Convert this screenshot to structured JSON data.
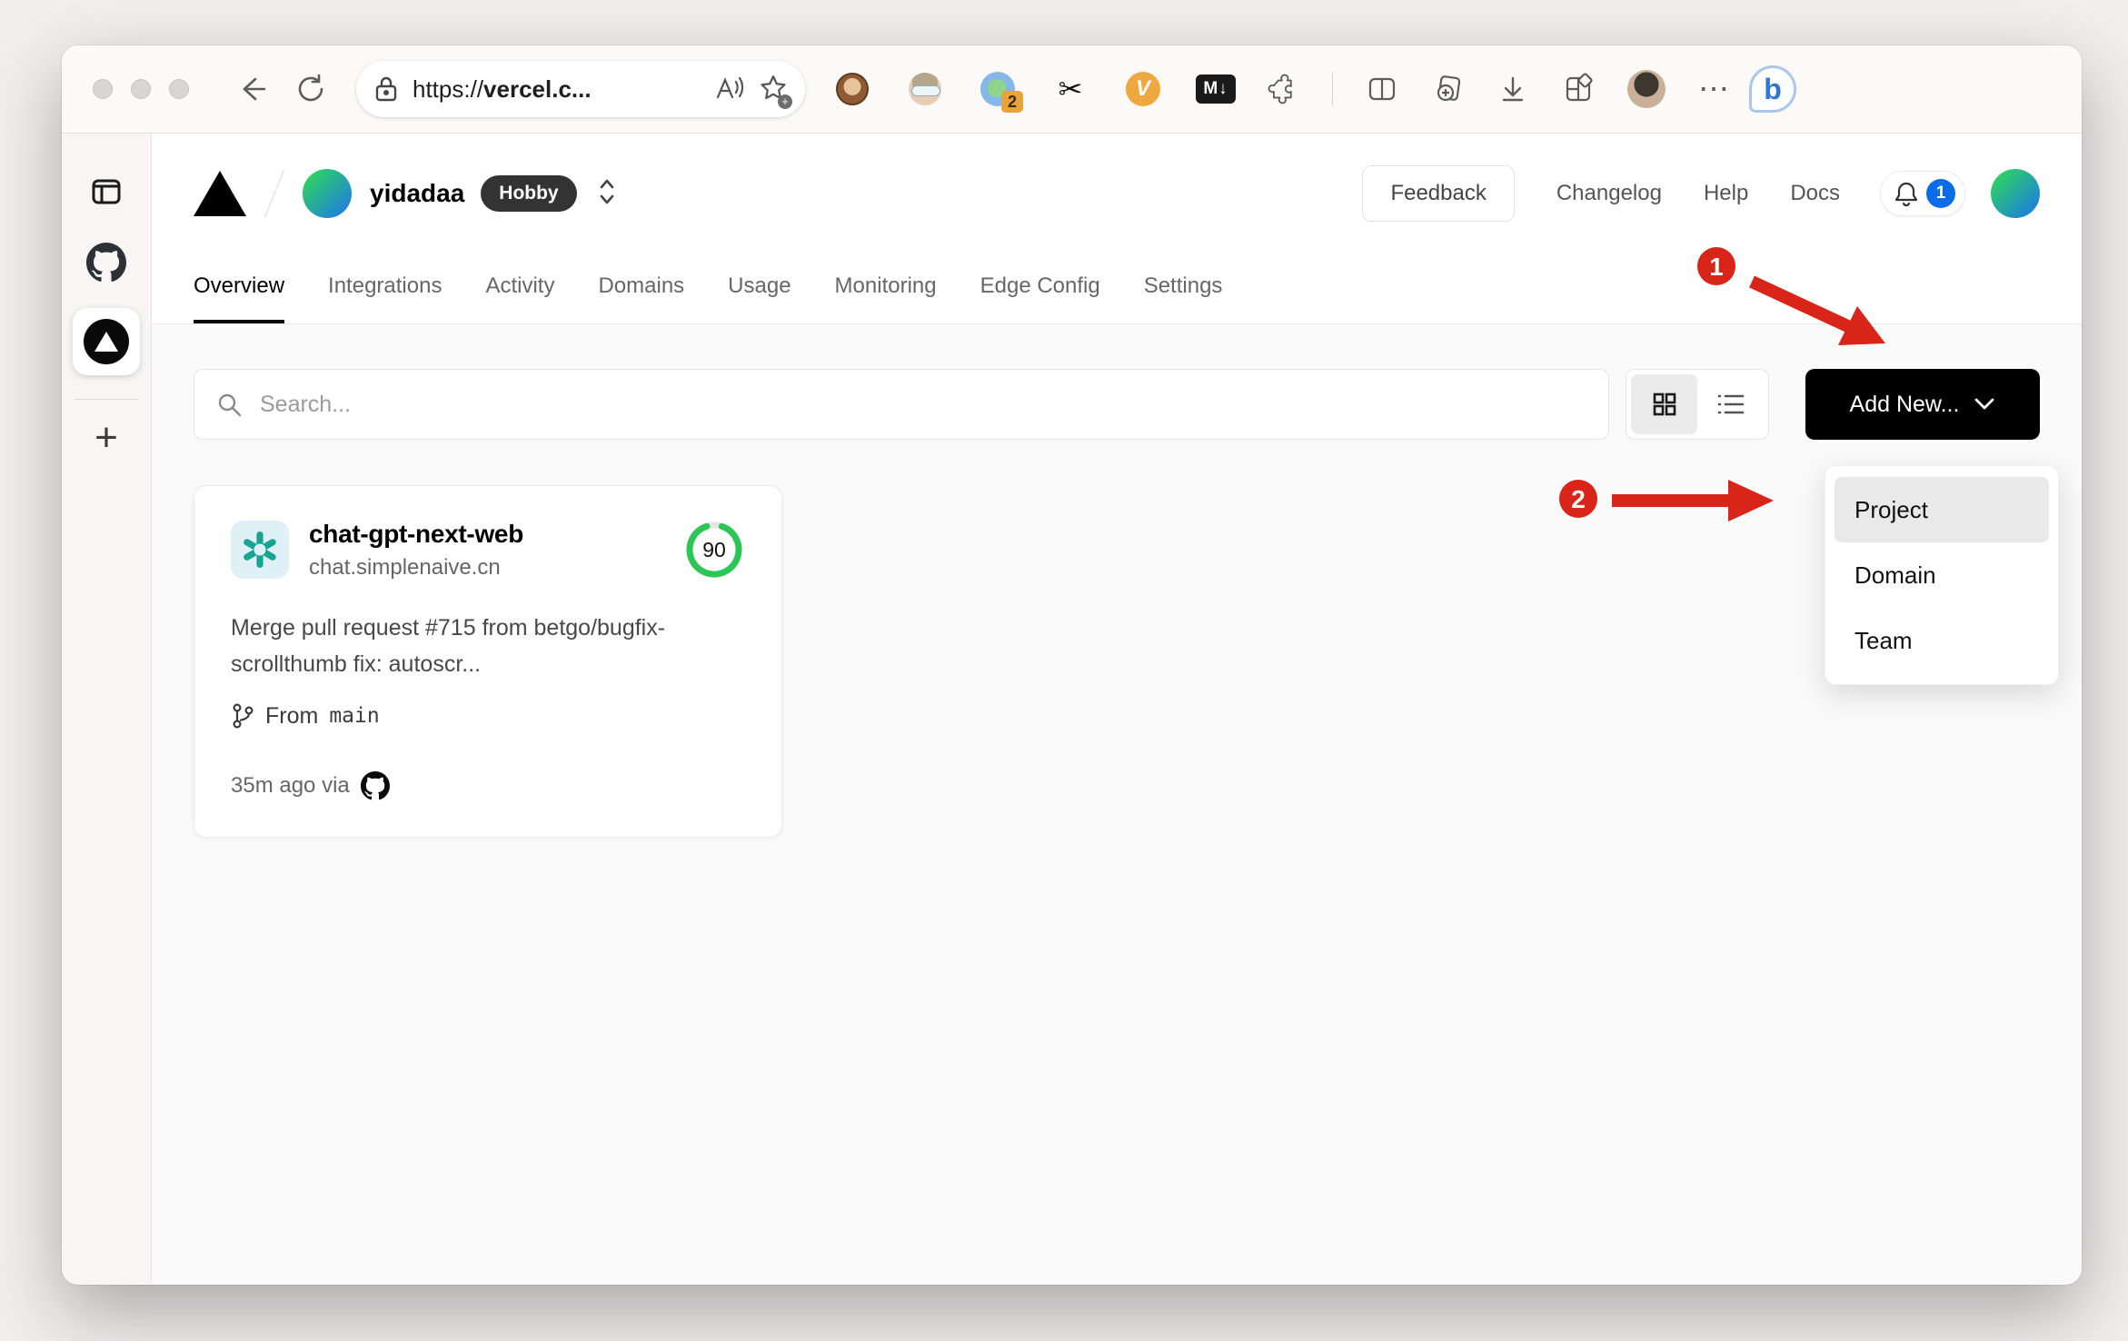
{
  "browser": {
    "url_scheme": "https://",
    "url_domain": "vercel.c...",
    "ext_badge": "2",
    "ext_scissors": "✂",
    "ext_v": "V",
    "ext_markdown": "M↓",
    "more": "⋯",
    "bing_letter": "b"
  },
  "edge_sidebar": {
    "plus": "+"
  },
  "header": {
    "team_name": "yidadaa",
    "plan_badge": "Hobby",
    "feedback_label": "Feedback",
    "links": [
      "Changelog",
      "Help",
      "Docs"
    ],
    "notification_count": "1"
  },
  "tabs": {
    "items": [
      "Overview",
      "Integrations",
      "Activity",
      "Domains",
      "Usage",
      "Monitoring",
      "Edge Config",
      "Settings"
    ],
    "active": "Overview"
  },
  "toolbar": {
    "search_placeholder": "Search...",
    "add_new_label": "Add New..."
  },
  "project": {
    "name": "chat-gpt-next-web",
    "domain": "chat.simplenaive.cn",
    "score": "90",
    "score_color": "#2bc656",
    "commit_message": "Merge pull request #715 from betgo/bugfix-scrollthumb fix: autoscr...",
    "branch_prefix": "From",
    "branch_name": "main",
    "deploy_meta": "35m ago via"
  },
  "dropdown": {
    "items": [
      {
        "label": "Project",
        "highlighted": true
      },
      {
        "label": "Domain",
        "highlighted": false
      },
      {
        "label": "Team",
        "highlighted": false
      }
    ]
  },
  "annotations": {
    "step1": "1",
    "step2": "2",
    "color": "#d92419"
  }
}
